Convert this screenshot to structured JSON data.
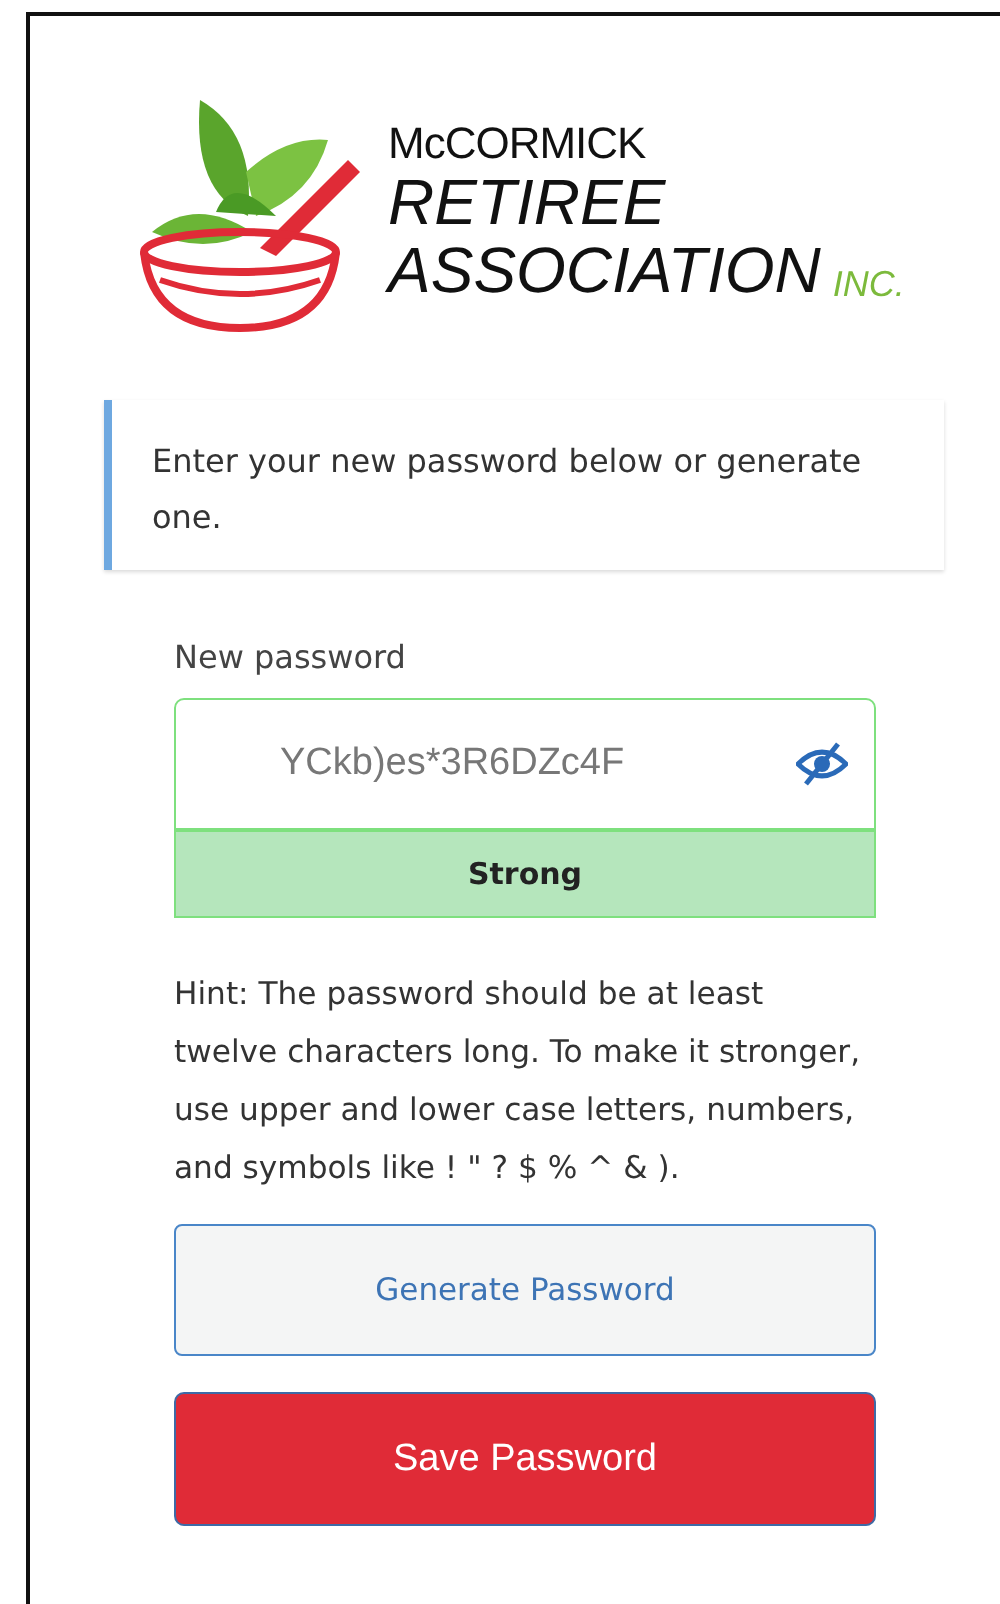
{
  "logo": {
    "line_1": "McCORMICK",
    "line_2": "RETIREE",
    "line_3": "ASSOCIATION",
    "suffix": "INC."
  },
  "message": "Enter your new password below or generate one.",
  "password": {
    "label": "New password",
    "value": "YCkb)es*3R6DZc4F",
    "strength": {
      "kind": "strong",
      "label": "Strong"
    }
  },
  "hint": "Hint: The password should be at least twelve characters long. To make it stronger, use upper and lower case letters, numbers, and symbols like ! \" ? $ % ^ & ).",
  "buttons": [
    {
      "kind": "secondary",
      "label": "Generate Password"
    },
    {
      "kind": "primary",
      "label": "Save Password"
    }
  ]
}
